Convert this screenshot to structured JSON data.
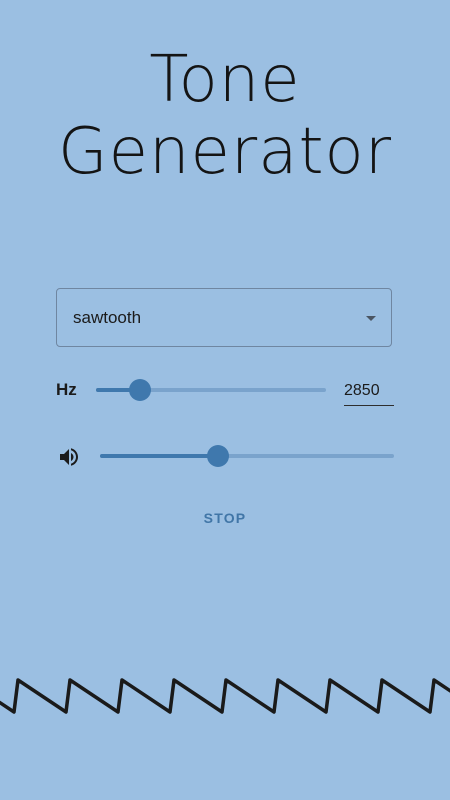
{
  "app": {
    "title_line1": "Tone",
    "title_line2": "Generator"
  },
  "waveform_select": {
    "value": "sawtooth"
  },
  "frequency": {
    "label": "Hz",
    "value": "2850",
    "slider_fraction": 0.19
  },
  "volume": {
    "icon": "volume-icon",
    "slider_fraction": 0.4
  },
  "actions": {
    "stop_label": "STOP"
  },
  "colors": {
    "background": "#9bbfe2",
    "accent": "#3f78ad",
    "track": "#7aa3cc",
    "waveform": "#1a1a1a"
  }
}
